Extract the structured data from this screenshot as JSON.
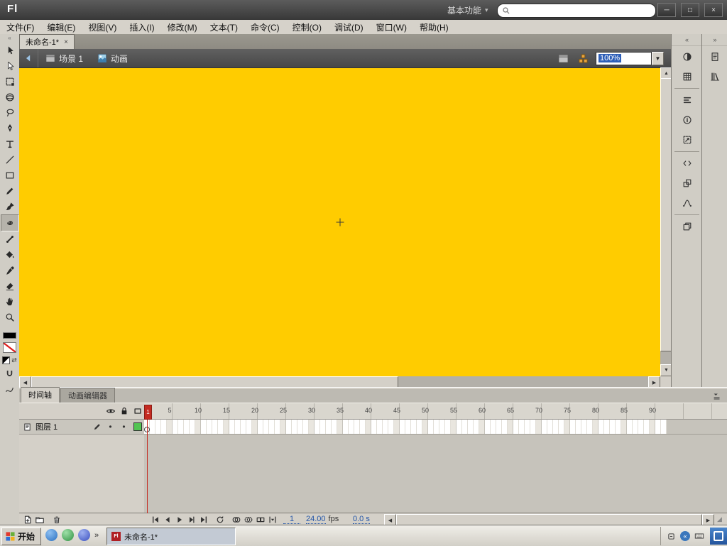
{
  "app": {
    "logo": "Fl",
    "workspace_switcher": "基本功能",
    "window_buttons": {
      "minimize": "─",
      "restore": "□",
      "close": "×"
    }
  },
  "search": {
    "placeholder": ""
  },
  "menubar": {
    "items": [
      "文件(F)",
      "编辑(E)",
      "视图(V)",
      "插入(I)",
      "修改(M)",
      "文本(T)",
      "命令(C)",
      "控制(O)",
      "调试(D)",
      "窗口(W)",
      "帮助(H)"
    ]
  },
  "document": {
    "tab_title": "未命名-1*",
    "tab_close": "×",
    "breadcrumb_scene": "场景 1",
    "breadcrumb_symbol": "动画",
    "zoom_value": "100%"
  },
  "tools": [
    "selection-tool",
    "subselection-tool",
    "free-transform-tool",
    "3d-rotation-tool",
    "lasso-tool",
    "pen-tool",
    "text-tool",
    "line-tool",
    "rectangle-tool",
    "pencil-tool",
    "brush-tool",
    "deco-tool",
    "bone-tool",
    "paint-bucket-tool",
    "eyedropper-tool",
    "eraser-tool",
    "hand-tool",
    "zoom-tool"
  ],
  "active_tool": "deco-tool",
  "color_controls": {
    "stroke_color": "#000000",
    "fill_color": "none"
  },
  "dock": {
    "strip1": [
      "color-panel",
      "swatches-panel",
      "divider",
      "align-panel",
      "info-panel",
      "transform-panel",
      "divider",
      "code-snippets-panel",
      "components-panel",
      "motion-presets-panel",
      "divider",
      "project-panel"
    ],
    "strip2": [
      "properties-panel",
      "library-panel"
    ]
  },
  "stage": {
    "color": "#FFCC00"
  },
  "timeline": {
    "tabs": [
      {
        "name": "tab-timeline",
        "label": "时间轴",
        "active": true
      },
      {
        "name": "tab-motion-editor",
        "label": "动画编辑器",
        "active": false
      }
    ],
    "header_icons": [
      "eye-icon",
      "lock-icon",
      "outline-icon"
    ],
    "layer": {
      "name": "图层 1",
      "outline_color": "#52c452"
    },
    "ruler_numbers": [
      5,
      10,
      15,
      20,
      25,
      30,
      35,
      40,
      45,
      50,
      55,
      60,
      65,
      70,
      75,
      80,
      85,
      90
    ],
    "frames_shown": 92,
    "keyframes": [
      1
    ],
    "current_frame": "1",
    "fps_value": "24.00",
    "fps_unit": "fps",
    "elapsed": "0.0 s",
    "layer_buttons": [
      "new-layer",
      "new-folder",
      "delete-layer"
    ],
    "control_buttons": [
      "goto-first-frame",
      "step-back",
      "play",
      "step-forward",
      "goto-last-frame",
      "loop",
      "onion-skin",
      "onion-outlines",
      "edit-multiple-frames",
      "modify-markers"
    ]
  },
  "taskbar": {
    "start_label": "开始",
    "quick_launch": [
      "quick-launch-1",
      "quick-launch-2",
      "quick-launch-3"
    ],
    "more_chevron": "»",
    "task": {
      "icon": "Fl",
      "label": "未命名-1*"
    }
  }
}
